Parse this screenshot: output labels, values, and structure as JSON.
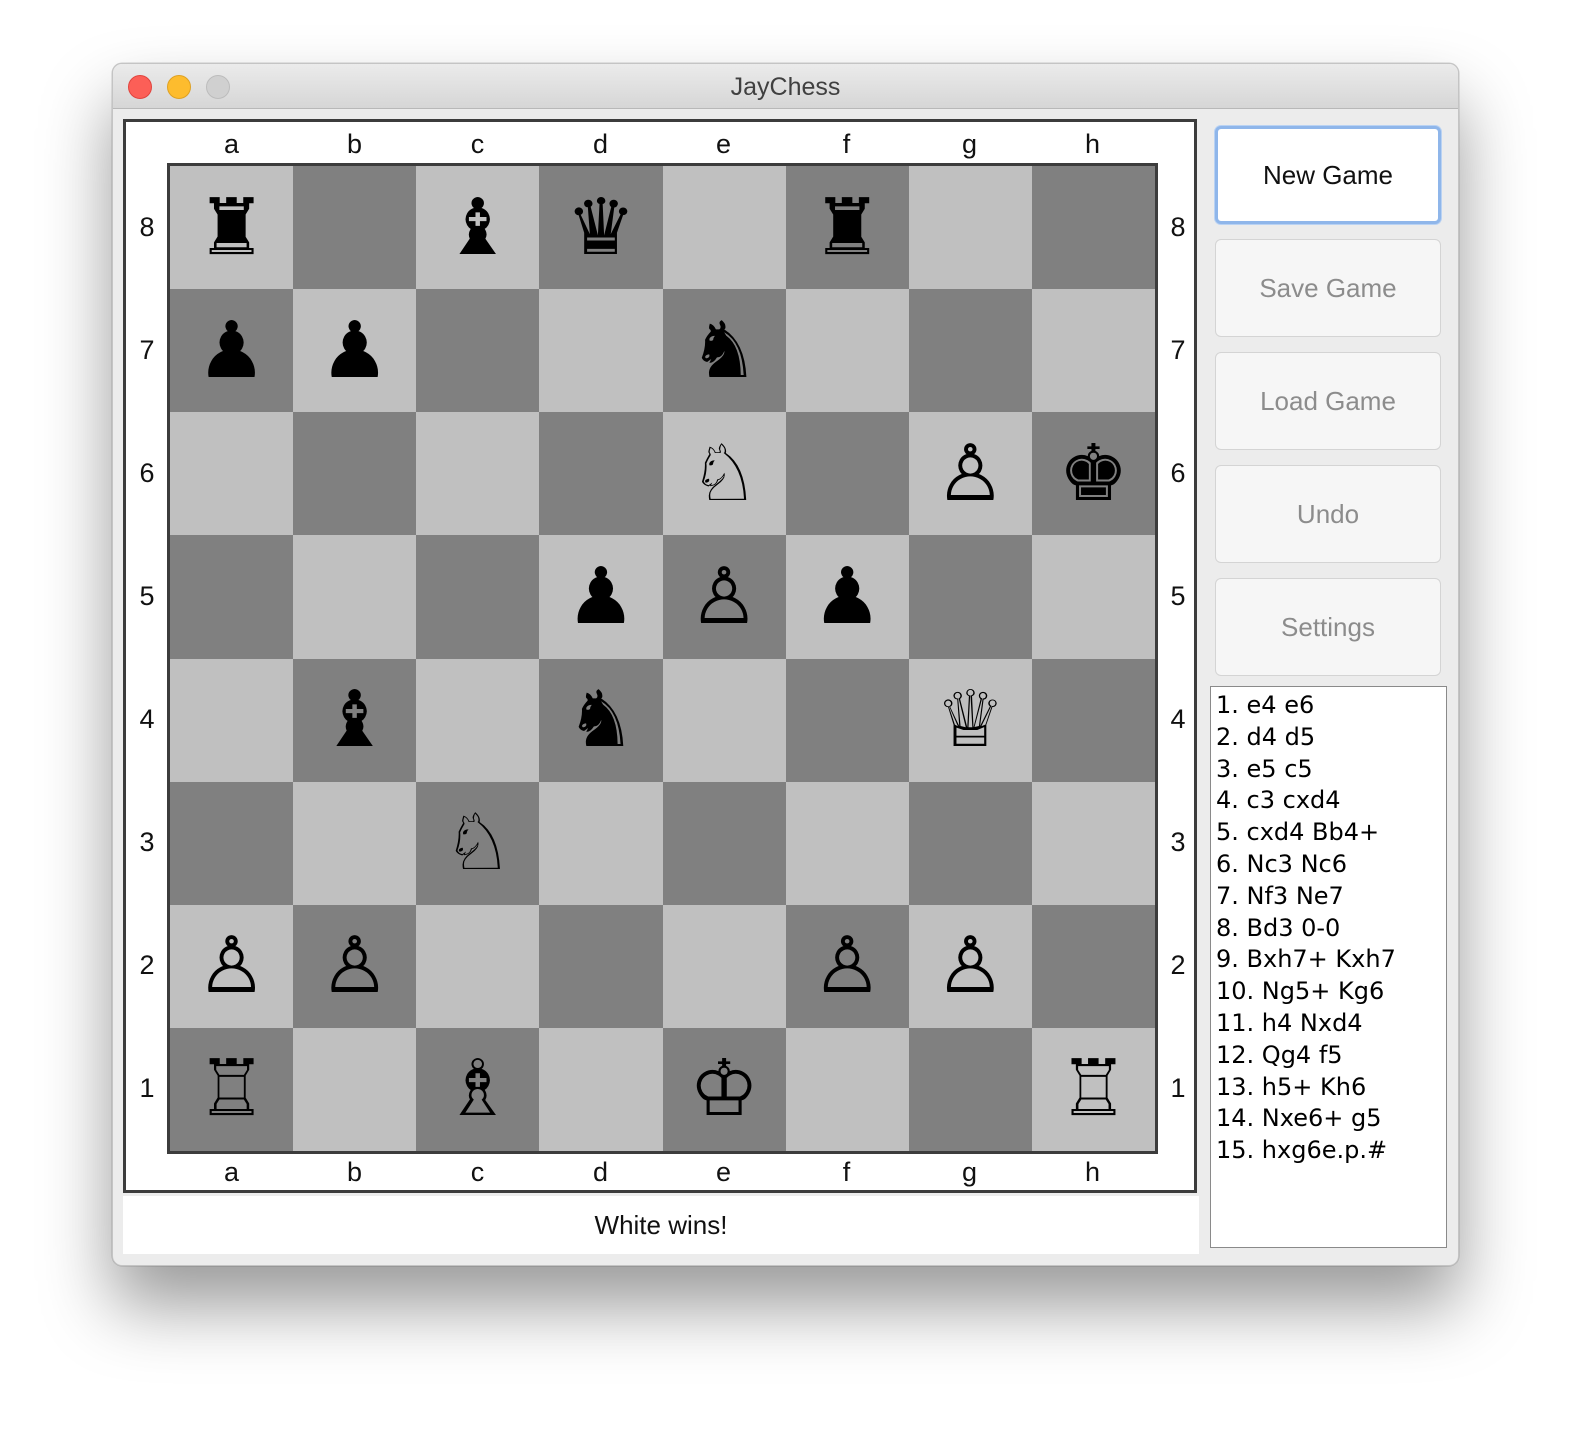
{
  "window": {
    "title": "JayChess"
  },
  "board": {
    "files": [
      "a",
      "b",
      "c",
      "d",
      "e",
      "f",
      "g",
      "h"
    ],
    "ranks": [
      "8",
      "7",
      "6",
      "5",
      "4",
      "3",
      "2",
      "1"
    ],
    "position": [
      [
        "bR",
        "",
        "bB",
        "bQ",
        "",
        "bR",
        "",
        ""
      ],
      [
        "bP",
        "bP",
        "",
        "",
        "bN",
        "",
        "",
        ""
      ],
      [
        "",
        "",
        "",
        "",
        "wN",
        "",
        "wP",
        "bK"
      ],
      [
        "",
        "",
        "",
        "bP",
        "wP",
        "bP",
        "",
        ""
      ],
      [
        "",
        "bB",
        "",
        "bN",
        "",
        "",
        "wQ",
        ""
      ],
      [
        "",
        "",
        "wN",
        "",
        "",
        "",
        "",
        ""
      ],
      [
        "wP",
        "wP",
        "",
        "",
        "",
        "wP",
        "wP",
        ""
      ],
      [
        "wR",
        "",
        "wB",
        "",
        "wK",
        "",
        "",
        "wR"
      ]
    ],
    "glyphs": {
      "wK": "♔",
      "wQ": "♕",
      "wR": "♖",
      "wB": "♗",
      "wN": "♘",
      "wP": "♙",
      "bK": "♚",
      "bQ": "♛",
      "bR": "♜",
      "bB": "♝",
      "bN": "♞",
      "bP": "♟"
    },
    "piece_names": {
      "wK": "white-king",
      "wQ": "white-queen",
      "wR": "white-rook",
      "wB": "white-bishop",
      "wN": "white-knight",
      "wP": "white-pawn",
      "bK": "black-king",
      "bQ": "black-queen",
      "bR": "black-rook",
      "bB": "black-bishop",
      "bN": "black-knight",
      "bP": "black-pawn"
    },
    "colors": {
      "light_square": "#c0c0c0",
      "dark_square": "#808080"
    }
  },
  "status": {
    "text": "White wins!"
  },
  "buttons": {
    "new_game": "New Game",
    "save_game": "Save Game",
    "load_game": "Load Game",
    "undo": "Undo",
    "settings": "Settings"
  },
  "moves": [
    "1. e4 e6",
    "2. d4 d5",
    "3. e5 c5",
    "4. c3 cxd4",
    "5. cxd4 Bb4+",
    "6. Nc3 Nc6",
    "7. Nf3 Ne7",
    "8. Bd3 0-0",
    "9. Bxh7+ Kxh7",
    "10. Ng5+ Kg6",
    "11. h4 Nxd4",
    "12. Qg4 f5",
    "13. h5+ Kh6",
    "14. Nxe6+ g5",
    "15. hxg6e.p.#"
  ]
}
